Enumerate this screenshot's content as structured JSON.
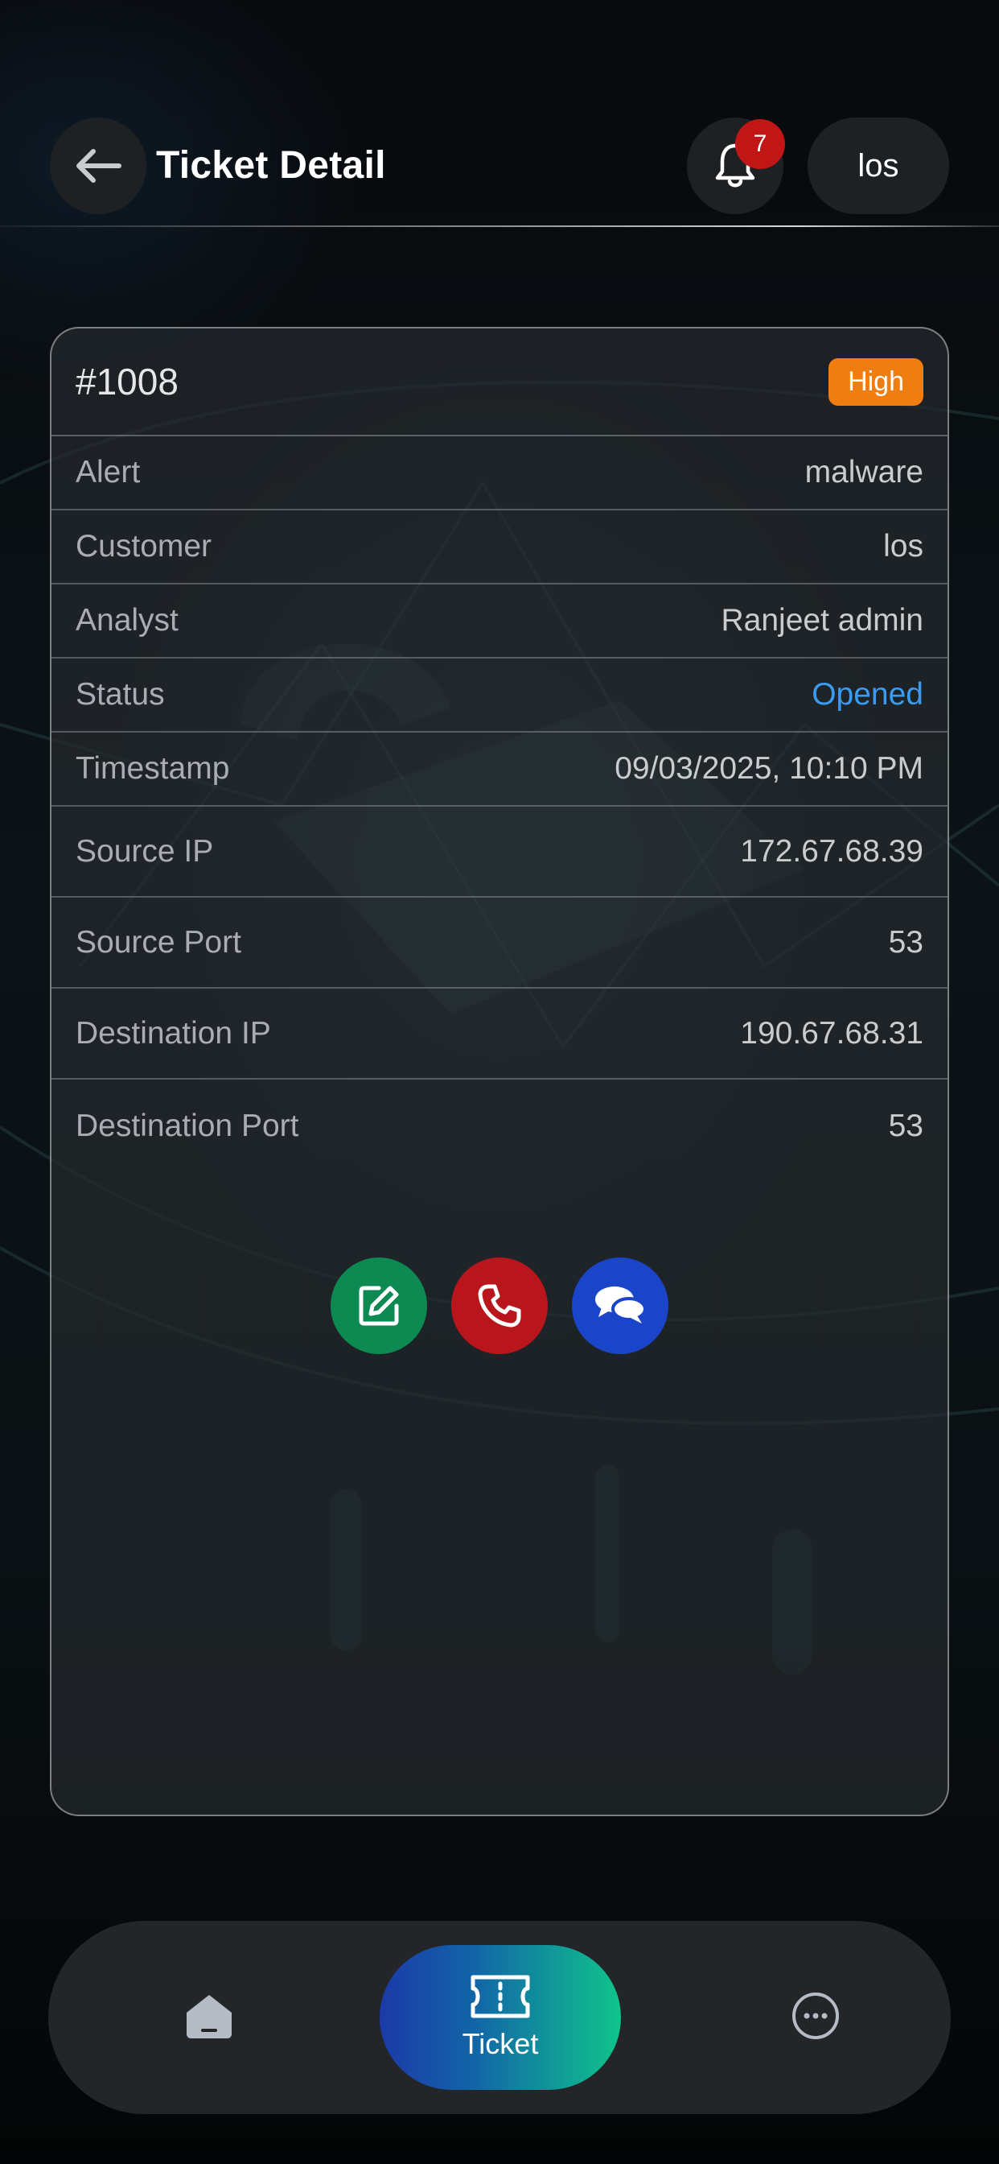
{
  "header": {
    "title": "Ticket Detail",
    "notification_count": "7",
    "user_label": "los"
  },
  "ticket": {
    "id": "#1008",
    "priority": "High",
    "fields": [
      {
        "label": "Alert",
        "value": "malware"
      },
      {
        "label": "Customer",
        "value": "los"
      },
      {
        "label": "Analyst",
        "value": "Ranjeet admin"
      },
      {
        "label": "Status",
        "value": "Opened"
      },
      {
        "label": "Timestamp",
        "value": "09/03/2025, 10:10 PM"
      },
      {
        "label": "Source IP",
        "value": "172.67.68.39"
      },
      {
        "label": "Source Port",
        "value": "53"
      },
      {
        "label": "Destination IP",
        "value": "190.67.68.31"
      },
      {
        "label": "Destination Port",
        "value": "53"
      }
    ]
  },
  "actions": {
    "icons": [
      "edit-icon",
      "phone-icon",
      "chat-icon"
    ],
    "colors": {
      "edit": "#0d8a52",
      "call": "#b8161c",
      "chat": "#1b45c9"
    }
  },
  "nav": {
    "items": [
      {
        "icon": "home-icon",
        "label": ""
      },
      {
        "icon": "ticket-icon",
        "label": "Ticket",
        "active": true
      },
      {
        "icon": "more-icon",
        "label": ""
      }
    ]
  },
  "colors": {
    "priority_high": "#f07d0f",
    "status_opened": "#3a9bf0",
    "badge": "#c01616"
  }
}
